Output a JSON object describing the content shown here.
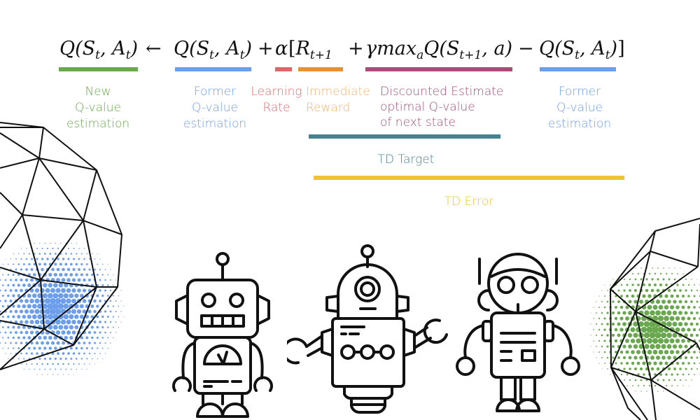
{
  "formula": {
    "parts": [
      {
        "id": "lhs",
        "text": "Q(St, At)"
      },
      {
        "id": "arrow",
        "text": "←"
      },
      {
        "id": "former",
        "text": "Q(St, At)"
      },
      {
        "id": "plus1",
        "text": "+"
      },
      {
        "id": "alpha",
        "text": "α"
      },
      {
        "id": "reward",
        "text": "[Rt+1"
      },
      {
        "id": "plus2",
        "text": "+"
      },
      {
        "id": "discounted",
        "text": "γmaxaQ(St+1, a)"
      },
      {
        "id": "minus",
        "text": "−"
      },
      {
        "id": "former2",
        "text": "Q(St, At)]"
      }
    ]
  },
  "annotations": [
    {
      "id": "new-q",
      "lines": [
        "New",
        "Q-value",
        "estimation"
      ],
      "color": "#6aa84f"
    },
    {
      "id": "former-q",
      "lines": [
        "Former",
        "Q-value",
        "estimation"
      ],
      "color": "#6d9eeb"
    },
    {
      "id": "learning-rate",
      "lines": [
        "Learning",
        "Rate"
      ],
      "color": "#e06666"
    },
    {
      "id": "immediate-reward",
      "lines": [
        "Immediate",
        "Reward"
      ],
      "color": "#f6b26b"
    },
    {
      "id": "discounted-estimate",
      "lines": [
        "Discounted Estimate",
        "optimal Q-value",
        "of next state"
      ],
      "color": "#a64d79"
    },
    {
      "id": "former-q-2",
      "lines": [
        "Former",
        "Q-value",
        "estimation"
      ],
      "color": "#6d9eeb"
    }
  ],
  "td_target": {
    "label": "TD Target",
    "color": "#45818e"
  },
  "td_error": {
    "label": "TD Error",
    "color": "#f1c232"
  },
  "colors": {
    "green": "#6aa84f",
    "blue": "#6d9eeb",
    "red": "#e06666",
    "orange": "#e69138",
    "purple": "#a64d79",
    "teal": "#45818e",
    "yellow": "#f1c232"
  }
}
